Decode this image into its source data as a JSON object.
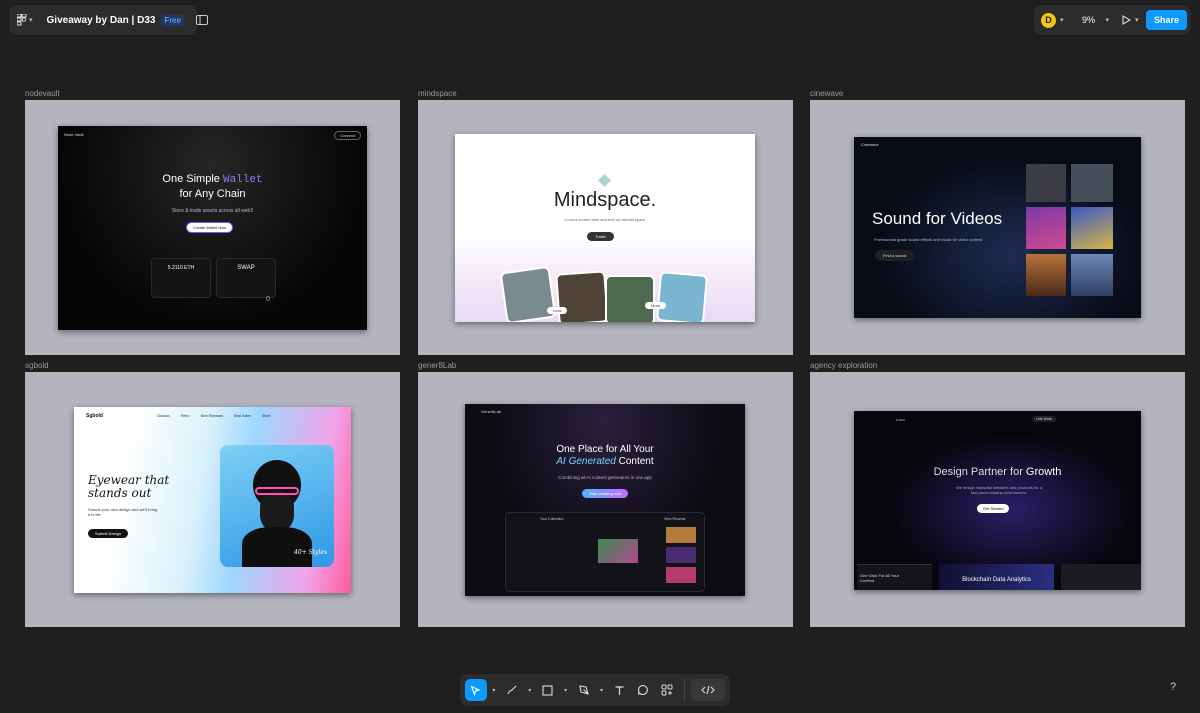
{
  "header": {
    "file_title": "Giveaway by Dan | D33",
    "plan_badge": "Free",
    "avatar_initial": "D",
    "zoom": "9%",
    "share_label": "Share"
  },
  "frames": [
    {
      "label": "nodevault",
      "brand": "Node Vault",
      "nav_cta": "Connect",
      "headline_1": "One Simple",
      "headline_accent": "Wallet",
      "headline_2": "for Any Chain",
      "subtitle": "Store & trade assets across all web3",
      "cta": "Create Wallet Now",
      "card_a": "5.2110 ETH",
      "card_b": "SWAP",
      "card_b_value": "0"
    },
    {
      "label": "mindspace",
      "headline": "Mindspace.",
      "subtitle": "Control screen time and free up mental space",
      "cta": "Trailer",
      "pill_less": "Less",
      "pill_more": "More"
    },
    {
      "label": "cinewave",
      "brand": "Cinewave",
      "headline": "Sound for Videos",
      "subtitle": "Professional grade sound effects and music for video content.",
      "cta": "Find a sound"
    },
    {
      "label": "sgbold",
      "brand": "Sgbold",
      "nav": [
        "Classics",
        "Retro",
        "New Releases",
        "Best Sales",
        "Store"
      ],
      "headline": "Eyewear that stands out",
      "subtitle": "Submit your own design and we'll bring it to life",
      "cta": "Submit Design",
      "tag": "40+ Styles"
    },
    {
      "label": "gener8Lab",
      "brand": "Gener8Lab",
      "headline_1": "One Place for All Your",
      "headline_accent": "AI Generated",
      "headline_2": "Content",
      "subtitle": "Combining all AI content generators in one app",
      "cta": "Start creating now",
      "panel_title": "Your Collection",
      "panel_right": "View Recents"
    },
    {
      "label": "agency exploration",
      "brand": "Loco",
      "nav_cta": "Lets Work",
      "headline_1": "Design Partner for",
      "headline_accent": "Growth",
      "subtitle": "We design impactful websites and products for a fast paced startup environment.",
      "cta": "Get Started",
      "card_1": "One Click For All Your Content",
      "card_2": "Blockchain Data Analytics"
    }
  ],
  "toolbar": {
    "tools": [
      "move-tool",
      "draw-tool",
      "frame-tool",
      "pen-tool",
      "text-tool",
      "comment-tool",
      "components-tool",
      "dev-mode-tool"
    ]
  },
  "help_label": "?",
  "colors": {
    "canvas": "#1e1e1e",
    "panel": "#2c2c2c",
    "accent": "#0d99ff",
    "frame_bg": "#b4b4bf"
  }
}
